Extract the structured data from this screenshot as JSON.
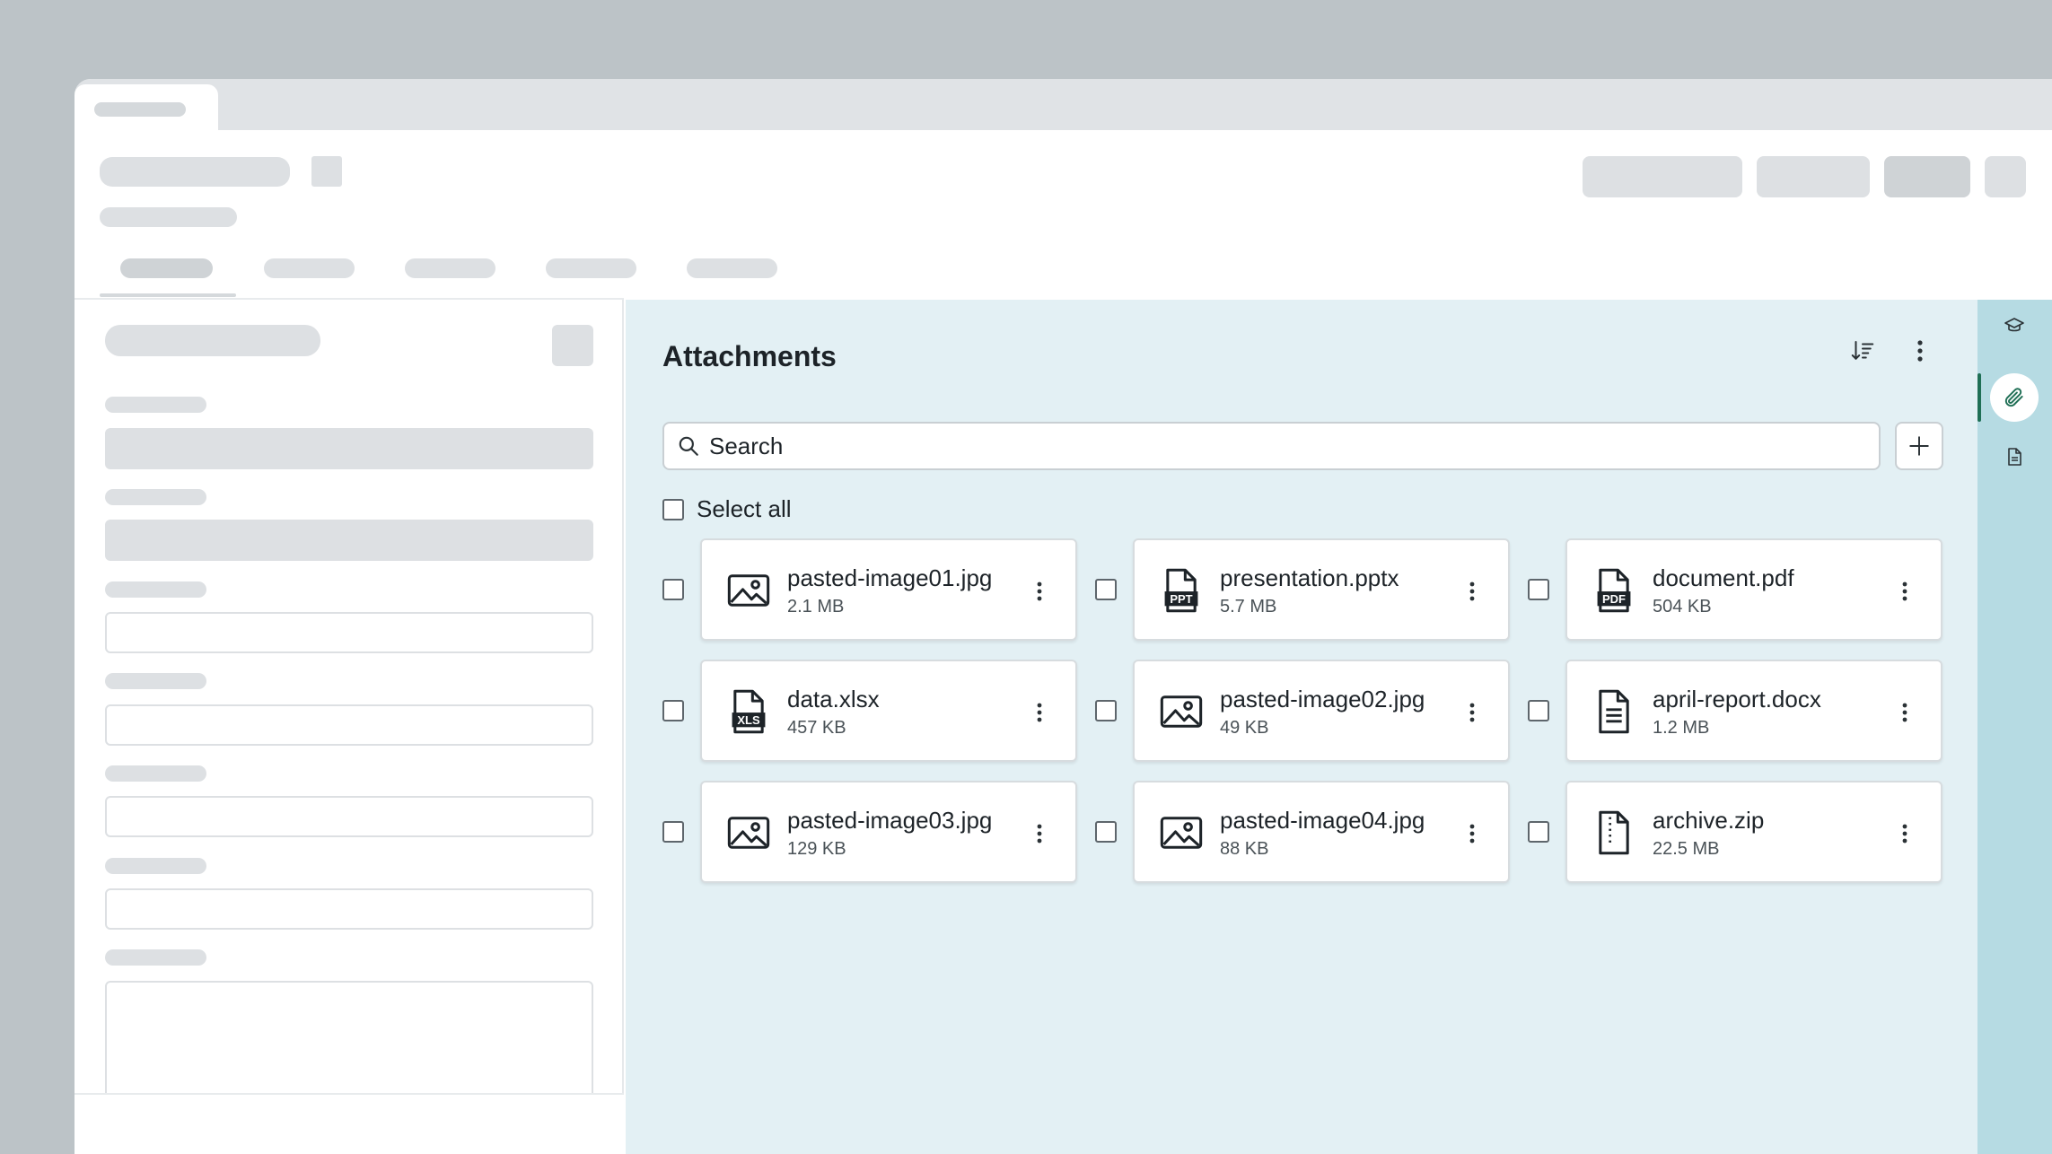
{
  "attachments": {
    "title": "Attachments",
    "search": {
      "placeholder": "Search",
      "value": ""
    },
    "select_all_label": "Select all",
    "files": [
      {
        "name": "pasted-image01.jpg",
        "size": "2.1 MB",
        "icon": "image-icon"
      },
      {
        "name": "presentation.pptx",
        "size": "5.7 MB",
        "icon": "ppt-file-icon",
        "badge": "PPT"
      },
      {
        "name": "document.pdf",
        "size": "504 KB",
        "icon": "pdf-file-icon",
        "badge": "PDF"
      },
      {
        "name": "data.xlsx",
        "size": "457 KB",
        "icon": "xls-file-icon",
        "badge": "XLS"
      },
      {
        "name": "pasted-image02.jpg",
        "size": "49 KB",
        "icon": "image-icon"
      },
      {
        "name": "april-report.docx",
        "size": "1.2 MB",
        "icon": "document-file-icon"
      },
      {
        "name": "pasted-image03.jpg",
        "size": "129 KB",
        "icon": "image-icon"
      },
      {
        "name": "pasted-image04.jpg",
        "size": "88 KB",
        "icon": "image-icon"
      },
      {
        "name": "archive.zip",
        "size": "22.5 MB",
        "icon": "zip-file-icon"
      }
    ]
  },
  "rail": {
    "items": [
      {
        "icon": "graduation-cap-icon",
        "active": false
      },
      {
        "icon": "paperclip-icon",
        "active": true
      },
      {
        "icon": "document-icon",
        "active": false
      }
    ]
  },
  "colors": {
    "panel_bg": "#e3f0f4",
    "rail_bg": "#b6dbe3",
    "accent": "#1f6f55",
    "text": "#1d2328"
  }
}
